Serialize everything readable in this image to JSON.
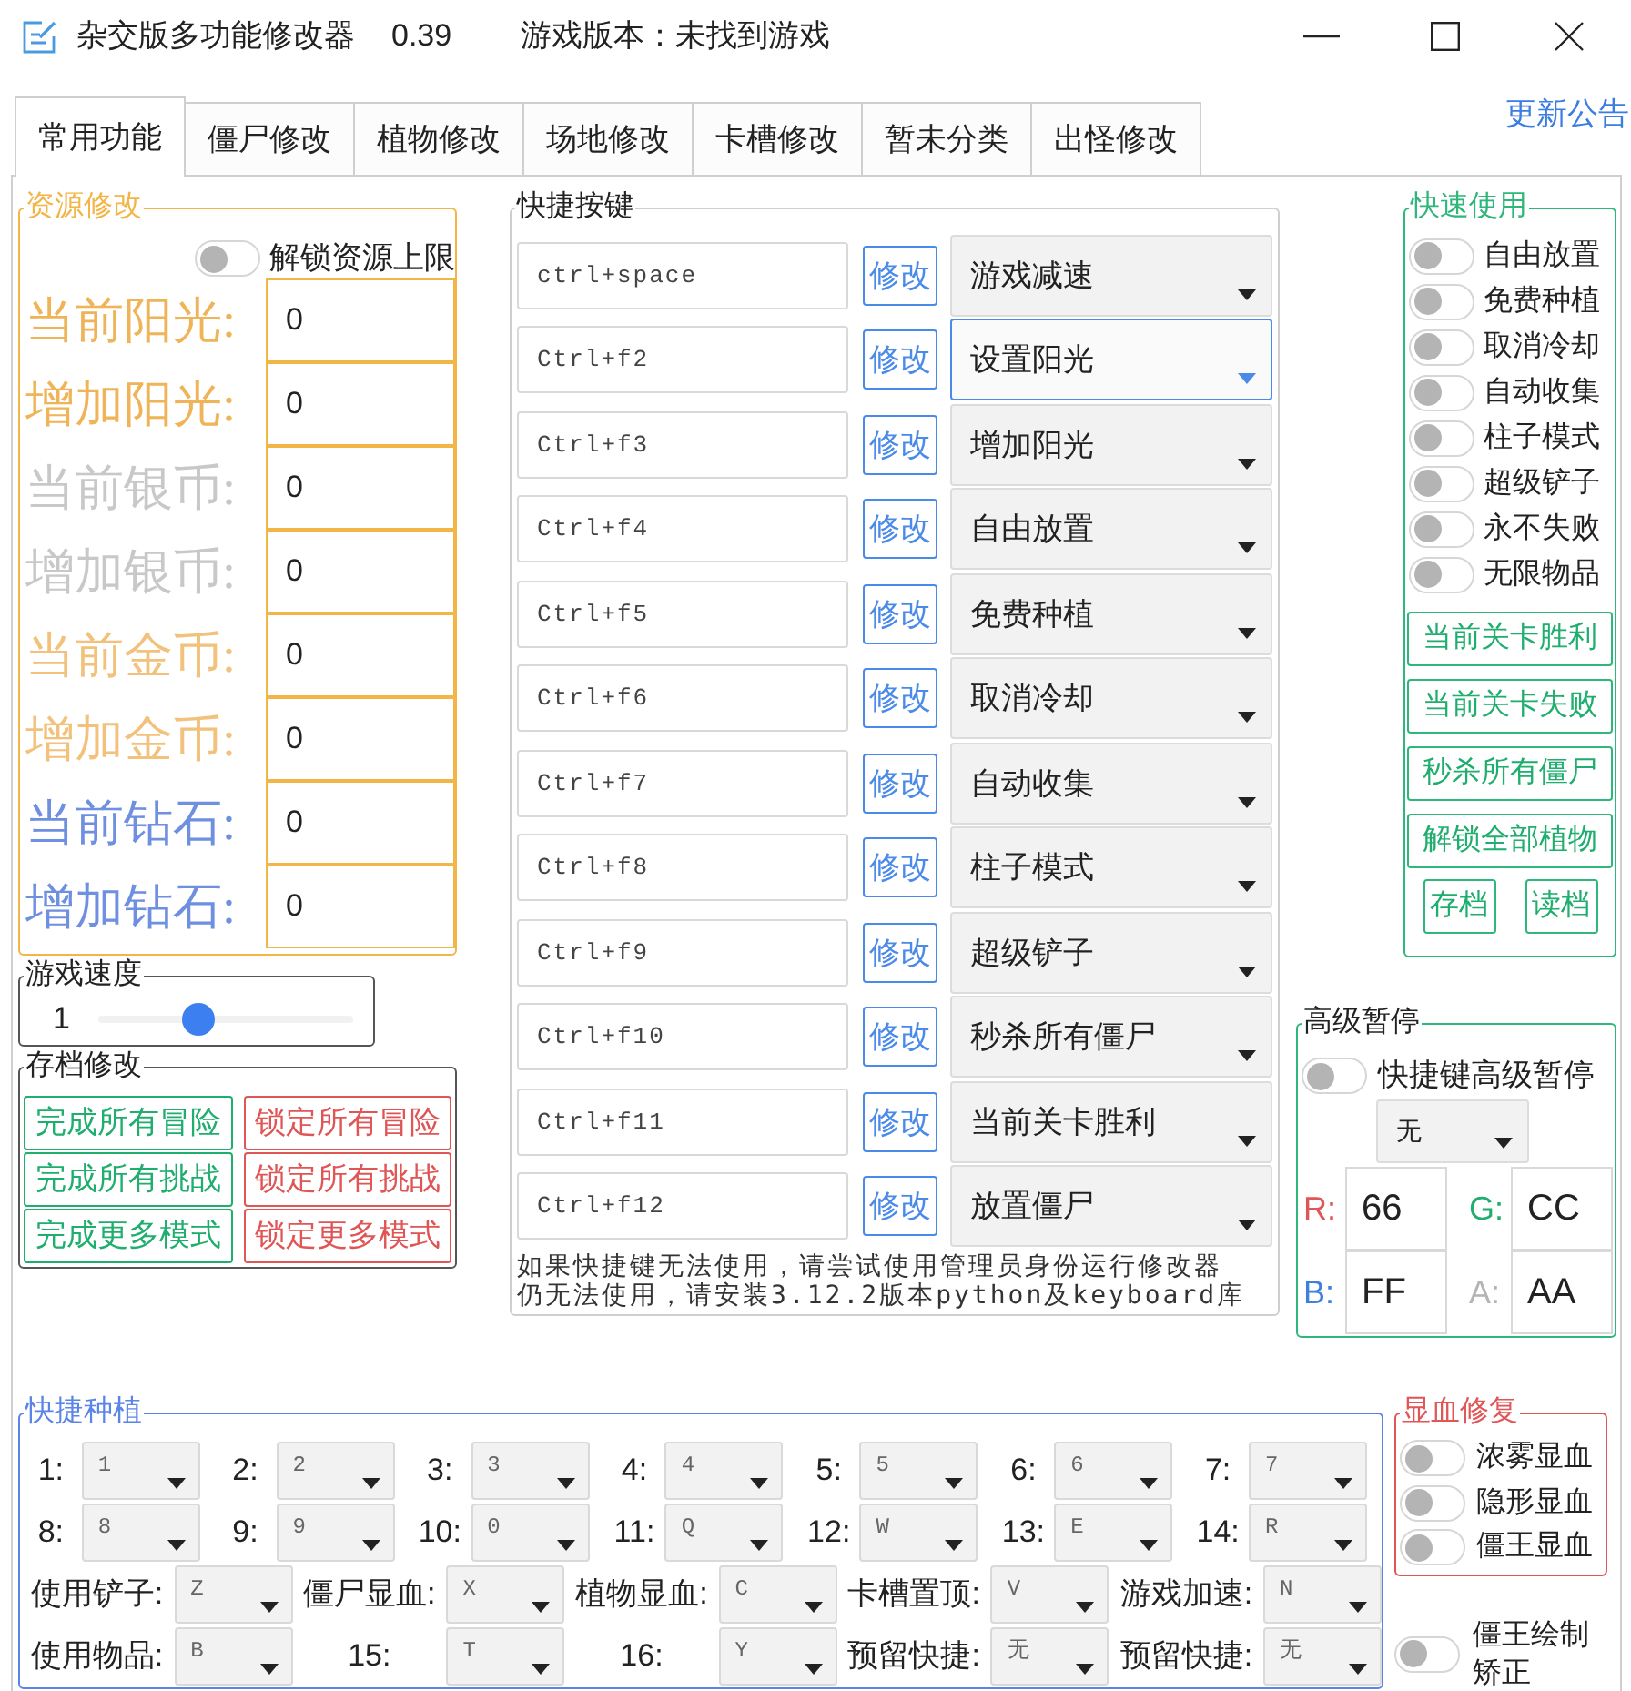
{
  "window": {
    "title": "杂交版多功能修改器",
    "version": "0.39",
    "game_status": "游戏版本：未找到游戏"
  },
  "tabs": [
    {
      "label": "常用功能",
      "selected": true
    },
    {
      "label": "僵尸修改",
      "selected": false
    },
    {
      "label": "植物修改",
      "selected": false
    },
    {
      "label": "场地修改",
      "selected": false
    },
    {
      "label": "卡槽修改",
      "selected": false
    },
    {
      "label": "暂未分类",
      "selected": false
    },
    {
      "label": "出怪修改",
      "selected": false
    }
  ],
  "announcement_link": "更新公告",
  "resource_panel": {
    "title": "资源修改",
    "unlock_toggle": {
      "label": "解锁资源上限",
      "on": false
    },
    "fields": [
      {
        "label": "当前阳光:",
        "value": "0",
        "color": "#f0b458"
      },
      {
        "label": "增加阳光:",
        "value": "0",
        "color": "#f0b458"
      },
      {
        "label": "当前银币:",
        "value": "0",
        "color": "#c8c8c8"
      },
      {
        "label": "增加银币:",
        "value": "0",
        "color": "#c8c8c8"
      },
      {
        "label": "当前金币:",
        "value": "0",
        "color": "#f2c27c"
      },
      {
        "label": "增加金币:",
        "value": "0",
        "color": "#f2c27c"
      },
      {
        "label": "当前钻石:",
        "value": "0",
        "color": "#6f8fe0"
      },
      {
        "label": "增加钻石:",
        "value": "0",
        "color": "#6f8fe0"
      }
    ]
  },
  "speed_panel": {
    "title": "游戏速度",
    "value": "1",
    "level": 0.37
  },
  "save_panel": {
    "title": "存档修改",
    "buttons": [
      {
        "label": "完成所有冒险",
        "color": "#1fae6e"
      },
      {
        "label": "锁定所有冒险",
        "color": "#e05555"
      },
      {
        "label": "完成所有挑战",
        "color": "#1fae6e"
      },
      {
        "label": "锁定所有挑战",
        "color": "#e05555"
      },
      {
        "label": "完成更多模式",
        "color": "#1fae6e"
      },
      {
        "label": "锁定更多模式",
        "color": "#e05555"
      }
    ]
  },
  "hotkeys_panel": {
    "title": "快捷按键",
    "rows": [
      {
        "keys": "ctrl+space",
        "button": "修改",
        "action": "游戏减速",
        "focused": false
      },
      {
        "keys": "Ctrl+f2",
        "button": "修改",
        "action": "设置阳光",
        "focused": true
      },
      {
        "keys": "Ctrl+f3",
        "button": "修改",
        "action": "增加阳光",
        "focused": false
      },
      {
        "keys": "Ctrl+f4",
        "button": "修改",
        "action": "自由放置",
        "focused": false
      },
      {
        "keys": "Ctrl+f5",
        "button": "修改",
        "action": "免费种植",
        "focused": false
      },
      {
        "keys": "Ctrl+f6",
        "button": "修改",
        "action": "取消冷却",
        "focused": false
      },
      {
        "keys": "Ctrl+f7",
        "button": "修改",
        "action": "自动收集",
        "focused": false
      },
      {
        "keys": "Ctrl+f8",
        "button": "修改",
        "action": "柱子模式",
        "focused": false
      },
      {
        "keys": "Ctrl+f9",
        "button": "修改",
        "action": "超级铲子",
        "focused": false
      },
      {
        "keys": "Ctrl+f10",
        "button": "修改",
        "action": "秒杀所有僵尸",
        "focused": false
      },
      {
        "keys": "Ctrl+f11",
        "button": "修改",
        "action": "当前关卡胜利",
        "focused": false
      },
      {
        "keys": "Ctrl+f12",
        "button": "修改",
        "action": "放置僵尸",
        "focused": false
      }
    ],
    "notes": [
      "如果快捷键无法使用，请尝试使用管理员身份运行修改器",
      "仍无法使用，请安装3.12.2版本python及keyboard库"
    ]
  },
  "quick_use_panel": {
    "title": "快速使用",
    "toggles": [
      {
        "label": "自由放置",
        "on": false
      },
      {
        "label": "免费种植",
        "on": false
      },
      {
        "label": "取消冷却",
        "on": false
      },
      {
        "label": "自动收集",
        "on": false
      },
      {
        "label": "柱子模式",
        "on": false
      },
      {
        "label": "超级铲子",
        "on": false
      },
      {
        "label": "永不失败",
        "on": false
      },
      {
        "label": "无限物品",
        "on": false
      }
    ],
    "buttons": [
      "当前关卡胜利",
      "当前关卡失败",
      "秒杀所有僵尸",
      "解锁全部植物"
    ],
    "small_buttons": [
      "存档",
      "读档"
    ]
  },
  "advanced_pause_panel": {
    "title": "高级暂停",
    "toggle": {
      "label": "快捷键高级暂停",
      "on": false
    },
    "key_select": "无",
    "channels": [
      {
        "label": "R:",
        "value": "66",
        "color": "#e05555"
      },
      {
        "label": "G:",
        "value": "CC",
        "color": "#1fae6e"
      },
      {
        "label": "B:",
        "value": "FF",
        "color": "#3f7fe0"
      },
      {
        "label": "A:",
        "value": "AA",
        "color": "#b4b4b4"
      }
    ]
  },
  "quick_plant_panel": {
    "title": "快捷种植",
    "slots": [
      {
        "label": "1:",
        "value": "1"
      },
      {
        "label": "2:",
        "value": "2"
      },
      {
        "label": "3:",
        "value": "3"
      },
      {
        "label": "4:",
        "value": "4"
      },
      {
        "label": "5:",
        "value": "5"
      },
      {
        "label": "6:",
        "value": "6"
      },
      {
        "label": "7:",
        "value": "7"
      },
      {
        "label": "8:",
        "value": "8"
      },
      {
        "label": "9:",
        "value": "9"
      },
      {
        "label": "10:",
        "value": "0"
      },
      {
        "label": "11:",
        "value": "Q"
      },
      {
        "label": "12:",
        "value": "W"
      },
      {
        "label": "13:",
        "value": "E"
      },
      {
        "label": "14:",
        "value": "R"
      }
    ],
    "extra": [
      {
        "label": "使用铲子:",
        "value": "Z"
      },
      {
        "label": "僵尸显血:",
        "value": "X"
      },
      {
        "label": "植物显血:",
        "value": "C"
      },
      {
        "label": "卡槽置顶:",
        "value": "V"
      },
      {
        "label": "游戏加速:",
        "value": "N"
      },
      {
        "label": "使用物品:",
        "value": "B"
      },
      {
        "label": "15:",
        "value": "T"
      },
      {
        "label": "16:",
        "value": "Y"
      },
      {
        "label": "预留快捷:",
        "value": "无"
      },
      {
        "label": "预留快捷:",
        "value": "无"
      }
    ]
  },
  "blood_fix_panel": {
    "title": "显血修复",
    "toggles": [
      {
        "label": "浓雾显血",
        "on": false
      },
      {
        "label": "隐形显血",
        "on": false
      },
      {
        "label": "僵王显血",
        "on": false
      }
    ]
  },
  "boss_draw_toggle": {
    "label": "僵王绘制矫正",
    "on": false
  }
}
